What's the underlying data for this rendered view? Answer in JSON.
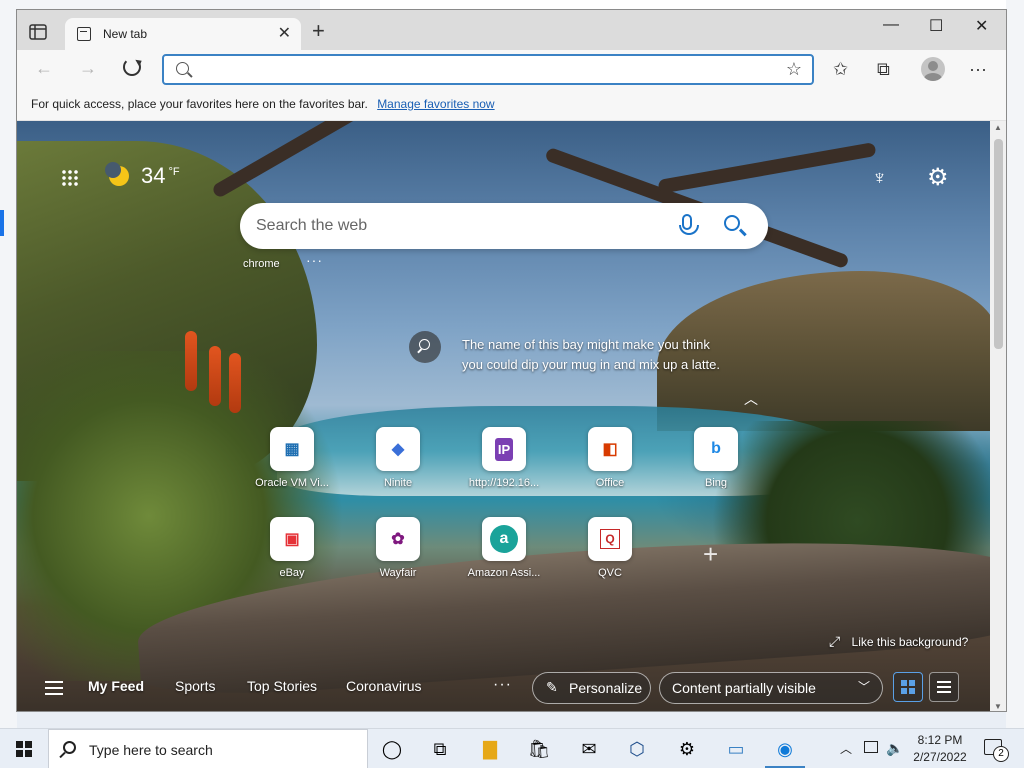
{
  "browser": {
    "tab": {
      "title": "New tab"
    },
    "address": {
      "value": "",
      "placeholder": ""
    },
    "favorites_bar": {
      "message": "For quick access, place your favorites here on the favorites bar.",
      "link": "Manage favorites now"
    }
  },
  "ntp": {
    "weather": {
      "temperature": "34",
      "unit": "°F"
    },
    "search": {
      "placeholder": "Search the web"
    },
    "quick_link": "chrome",
    "background_info": "The name of this bay might make you think you could dip your mug in and mix up a latte.",
    "like_background": "Like this background?",
    "tiles": [
      {
        "label": "Oracle VM Vi...",
        "glyph": "▦",
        "color": "#1f6fb2"
      },
      {
        "label": "Ninite",
        "glyph": "◆",
        "color": "#3a6fd8"
      },
      {
        "label": "http://192.16...",
        "glyph": "IP",
        "color": "#7b3fb3"
      },
      {
        "label": "Office",
        "glyph": "◧",
        "color": "#d83b01"
      },
      {
        "label": "Bing",
        "glyph": "b",
        "color": "#1e88e5"
      },
      {
        "label": "eBay",
        "glyph": "▣",
        "color": "#e53238"
      },
      {
        "label": "Wayfair",
        "glyph": "✿",
        "color": "#7f187f"
      },
      {
        "label": "Amazon Assi...",
        "glyph": "a",
        "color": "#1aa39a"
      },
      {
        "label": "QVC",
        "glyph": "Q",
        "color": "#c62828"
      }
    ],
    "feed": {
      "tabs": [
        "My Feed",
        "Sports",
        "Top Stories",
        "Coronavirus"
      ],
      "active_tab": "My Feed",
      "personalize": "Personalize",
      "visibility": "Content partially visible"
    }
  },
  "taskbar": {
    "search_placeholder": "Type here to search",
    "time": "8:12 PM",
    "date": "2/27/2022",
    "notifications": "2",
    "apps": [
      "task-view-icon",
      "file-explorer-icon",
      "store-icon",
      "mail-icon",
      "virtualbox-icon",
      "settings-icon",
      "remote-desktop-icon",
      "edge-icon"
    ]
  }
}
